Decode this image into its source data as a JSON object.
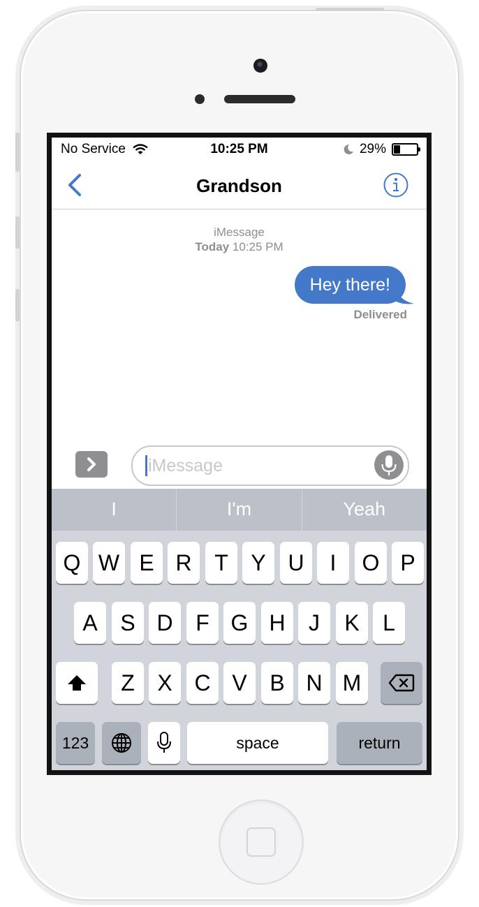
{
  "status_bar": {
    "carrier": "No Service",
    "time": "10:25 PM",
    "battery_percent": "29%",
    "battery_level": 0.29,
    "icons": [
      "wifi-icon",
      "moon-icon",
      "battery-icon"
    ]
  },
  "nav": {
    "title": "Grandson",
    "back_icon": "chevron-left-icon",
    "info_icon": "info-icon"
  },
  "thread": {
    "service": "iMessage",
    "date_bold": "Today",
    "time": "10:25 PM",
    "messages": [
      {
        "text": "Hey there!",
        "direction": "outgoing",
        "status": "Delivered"
      }
    ]
  },
  "input": {
    "placeholder": "iMessage",
    "expand_icon": "chevron-right-icon",
    "dictation_icon": "microphone-icon"
  },
  "keyboard": {
    "suggestions": [
      "I",
      "I'm",
      "Yeah"
    ],
    "row1": [
      "Q",
      "W",
      "E",
      "R",
      "T",
      "Y",
      "U",
      "I",
      "O",
      "P"
    ],
    "row2": [
      "A",
      "S",
      "D",
      "F",
      "G",
      "H",
      "J",
      "K",
      "L"
    ],
    "row3": [
      "Z",
      "X",
      "C",
      "V",
      "B",
      "N",
      "M"
    ],
    "numbers_label": "123",
    "space_label": "space",
    "return_label": "return",
    "icons": [
      "shift-icon",
      "backspace-icon",
      "globe-icon",
      "microphone-icon"
    ]
  },
  "colors": {
    "accent": "#4478c8",
    "bubble": "#4478c8",
    "keyboard_bg": "#d1d4da",
    "suggestion_bar": "#bcc0c8",
    "dark_key": "#abb1ba"
  }
}
